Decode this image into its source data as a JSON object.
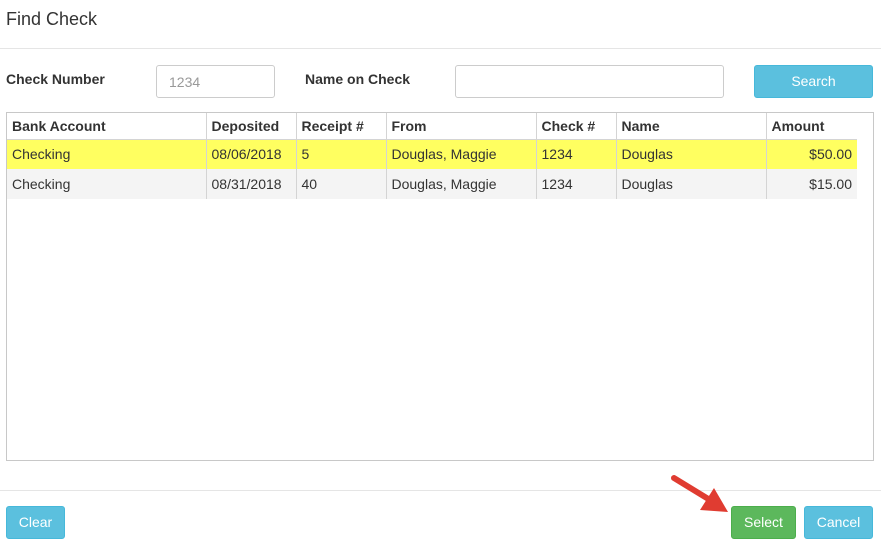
{
  "dialog": {
    "title": "Find Check"
  },
  "filters": {
    "check_number_label": "Check Number",
    "check_number_placeholder": "1234",
    "name_on_check_label": "Name on Check",
    "name_on_check_value": "",
    "search_label": "Search"
  },
  "grid": {
    "columns": [
      "Bank Account",
      "Deposited",
      "Receipt #",
      "From",
      "Check #",
      "Name",
      "Amount"
    ],
    "rows": [
      {
        "bank_account": "Checking",
        "deposited": "08/06/2018",
        "receipt": "5",
        "from": "Douglas, Maggie",
        "check": "1234",
        "name": "Douglas",
        "amount": "$50.00",
        "selected": true
      },
      {
        "bank_account": "Checking",
        "deposited": "08/31/2018",
        "receipt": "40",
        "from": "Douglas, Maggie",
        "check": "1234",
        "name": "Douglas",
        "amount": "$15.00",
        "selected": false
      }
    ]
  },
  "footer": {
    "clear_label": "Clear",
    "select_label": "Select",
    "cancel_label": "Cancel"
  },
  "colors": {
    "info": "#5bc0de",
    "success": "#5cb85c",
    "highlight": "#ffff60",
    "arrow": "#e03c31"
  },
  "annotation": {
    "icon": "arrow-icon",
    "points_to": "select-button"
  }
}
